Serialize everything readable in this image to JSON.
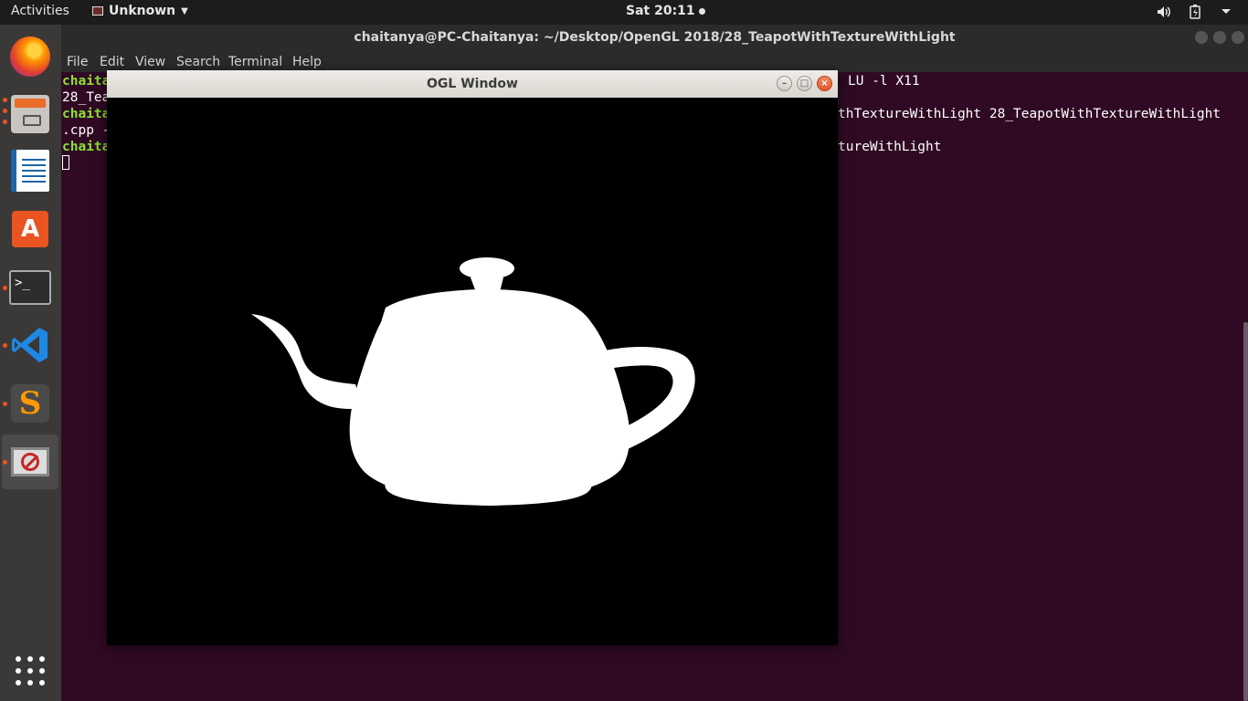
{
  "topbar": {
    "activities": "Activities",
    "app_name": "Unknown",
    "clock": "Sat 20:11",
    "tray_icons": [
      "volume-icon",
      "battery-icon",
      "power-menu-icon"
    ]
  },
  "dock": {
    "apps": [
      {
        "name": "Firefox",
        "icon": "firefox-icon",
        "running": false
      },
      {
        "name": "Files",
        "icon": "files-icon",
        "running": true
      },
      {
        "name": "LibreOffice Writer",
        "icon": "writer-icon",
        "running": false
      },
      {
        "name": "Ubuntu Software",
        "icon": "software-store-icon",
        "running": false
      },
      {
        "name": "Terminal",
        "icon": "terminal-icon",
        "running": true
      },
      {
        "name": "Visual Studio Code",
        "icon": "vscode-icon",
        "running": true
      },
      {
        "name": "Sublime Text",
        "icon": "sublime-icon",
        "running": true
      },
      {
        "name": "OGL Window",
        "icon": "ogl-app-icon",
        "running": true,
        "active": true
      }
    ],
    "show_apps": "show-applications-icon"
  },
  "terminal": {
    "title": "chaitanya@PC-Chaitanya: ~/Desktop/OpenGL 2018/28_TeapotWithTextureWithLight",
    "menu": [
      "File",
      "Edit",
      "View",
      "Search",
      "Terminal",
      "Help"
    ],
    "lines": [
      {
        "prompt": "chaita",
        "rest_visible": "LU -l X11"
      },
      {
        "prompt": "",
        "start": "28_Tea",
        "rest_visible": ""
      },
      {
        "prompt": "chaita",
        "rest_visible": "thTextureWithLight 28_TeapotWithTextureWithLight"
      },
      {
        "prompt": "",
        "start": ".cpp -",
        "rest_visible": ""
      },
      {
        "prompt": "chaita",
        "rest_visible": "tureWithLight"
      }
    ]
  },
  "ogl_window": {
    "title": "OGL Window",
    "buttons": {
      "minimize": "–",
      "maximize": "□",
      "close": "×"
    },
    "scene": {
      "background": "#000000",
      "object": "teapot",
      "object_color": "#ffffff"
    }
  },
  "colors": {
    "terminal_bg": "#300a24",
    "prompt_green": "#8ae234",
    "accent": "#e95420"
  }
}
